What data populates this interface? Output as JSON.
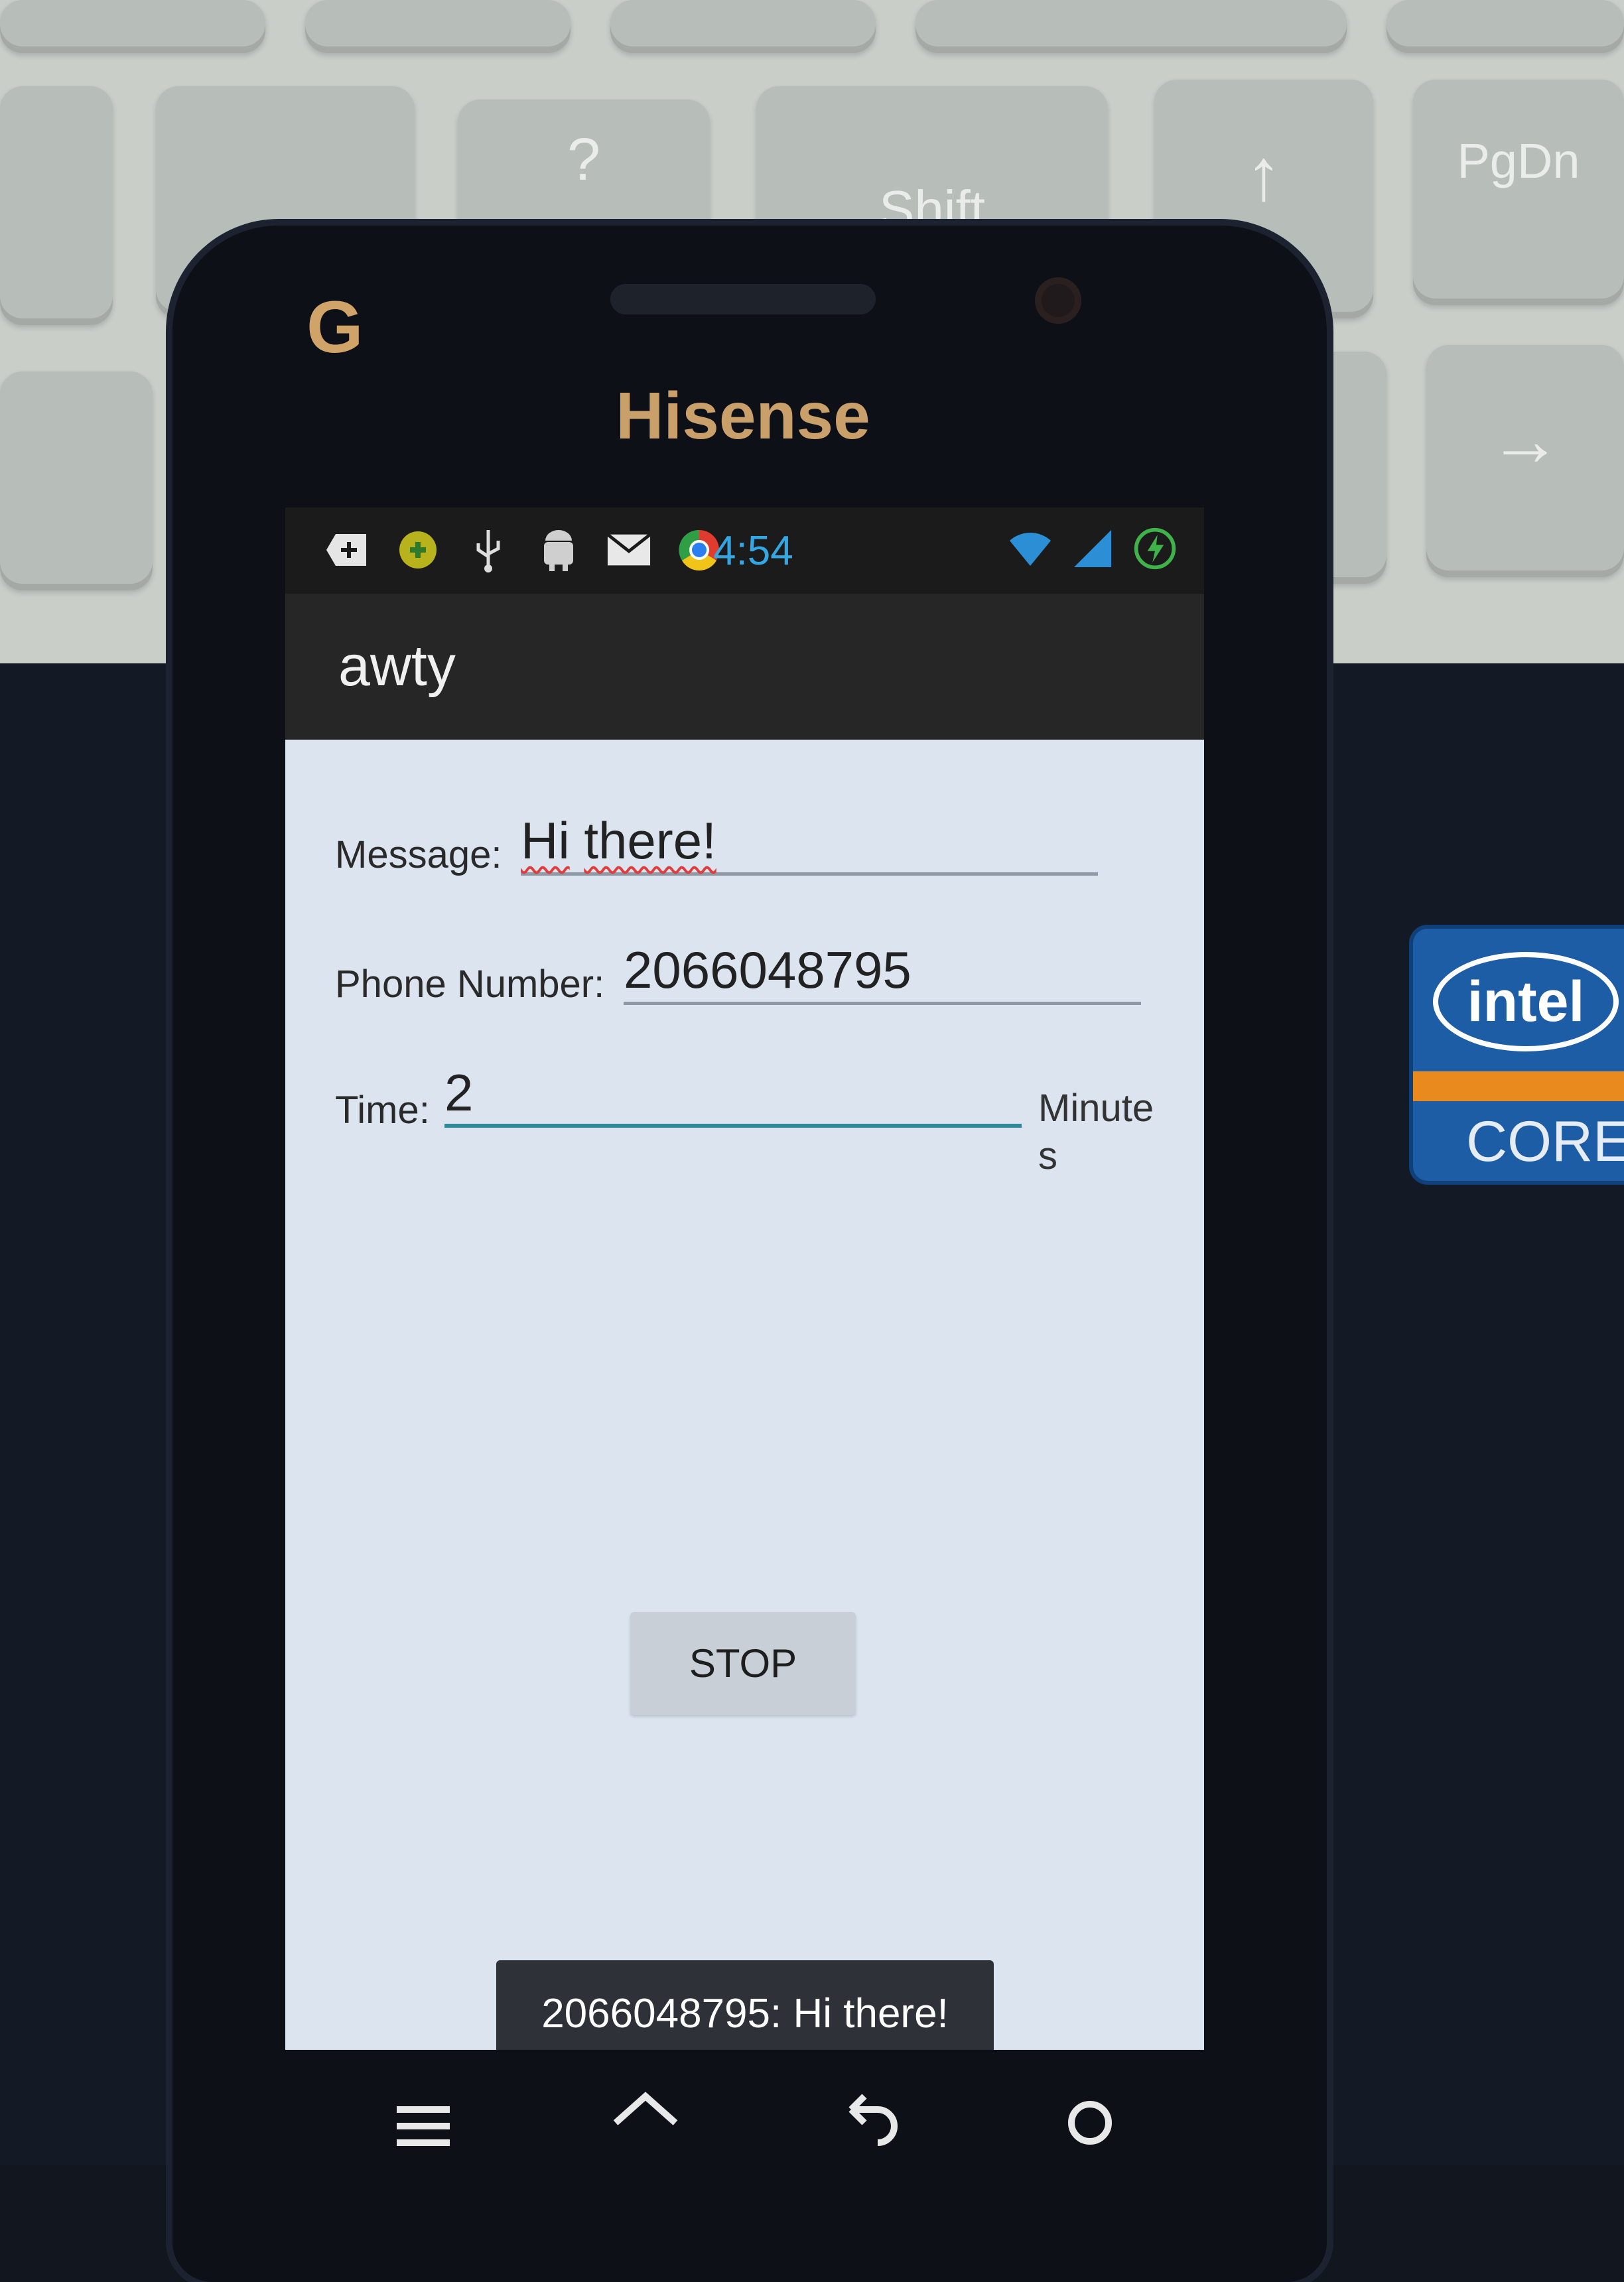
{
  "scene": {
    "keyboard_keys": [
      {
        "glyph": "?"
      },
      {
        "glyph": "Shift"
      },
      {
        "glyph": "↑"
      },
      {
        "glyph": "PgDn"
      },
      {
        "glyph": "→"
      }
    ],
    "badge": {
      "logo": "intel",
      "product": "CORE"
    }
  },
  "device": {
    "brand": "Hisense",
    "carrier_logo": "G"
  },
  "status_bar": {
    "time": "4:54",
    "left_icons": [
      "add-notification-icon",
      "app-notification-icon",
      "usb-icon",
      "android-debug-icon",
      "email-icon",
      "chrome-icon"
    ],
    "right_icons": [
      "wifi-icon",
      "signal-icon",
      "battery-charging-icon"
    ]
  },
  "app": {
    "title": "awty",
    "message": {
      "label": "Message:",
      "value": "Hi there!",
      "words": [
        "Hi",
        "there!"
      ]
    },
    "phone": {
      "label": "Phone Number:",
      "value": "2066048795"
    },
    "time": {
      "label": "Time:",
      "value": "2",
      "units": "Minutes"
    },
    "stop_button": "STOP",
    "toast": "2066048795: Hi there!"
  },
  "nav_bar": [
    "menu-icon",
    "home-icon",
    "back-icon",
    "search-icon"
  ],
  "colors": {
    "screen_bg": "#dbe4ef",
    "action_bar": "#262627",
    "clock": "#33a7e3",
    "field_focus": "#2d8a9a",
    "toast_bg": "#2e3138"
  }
}
